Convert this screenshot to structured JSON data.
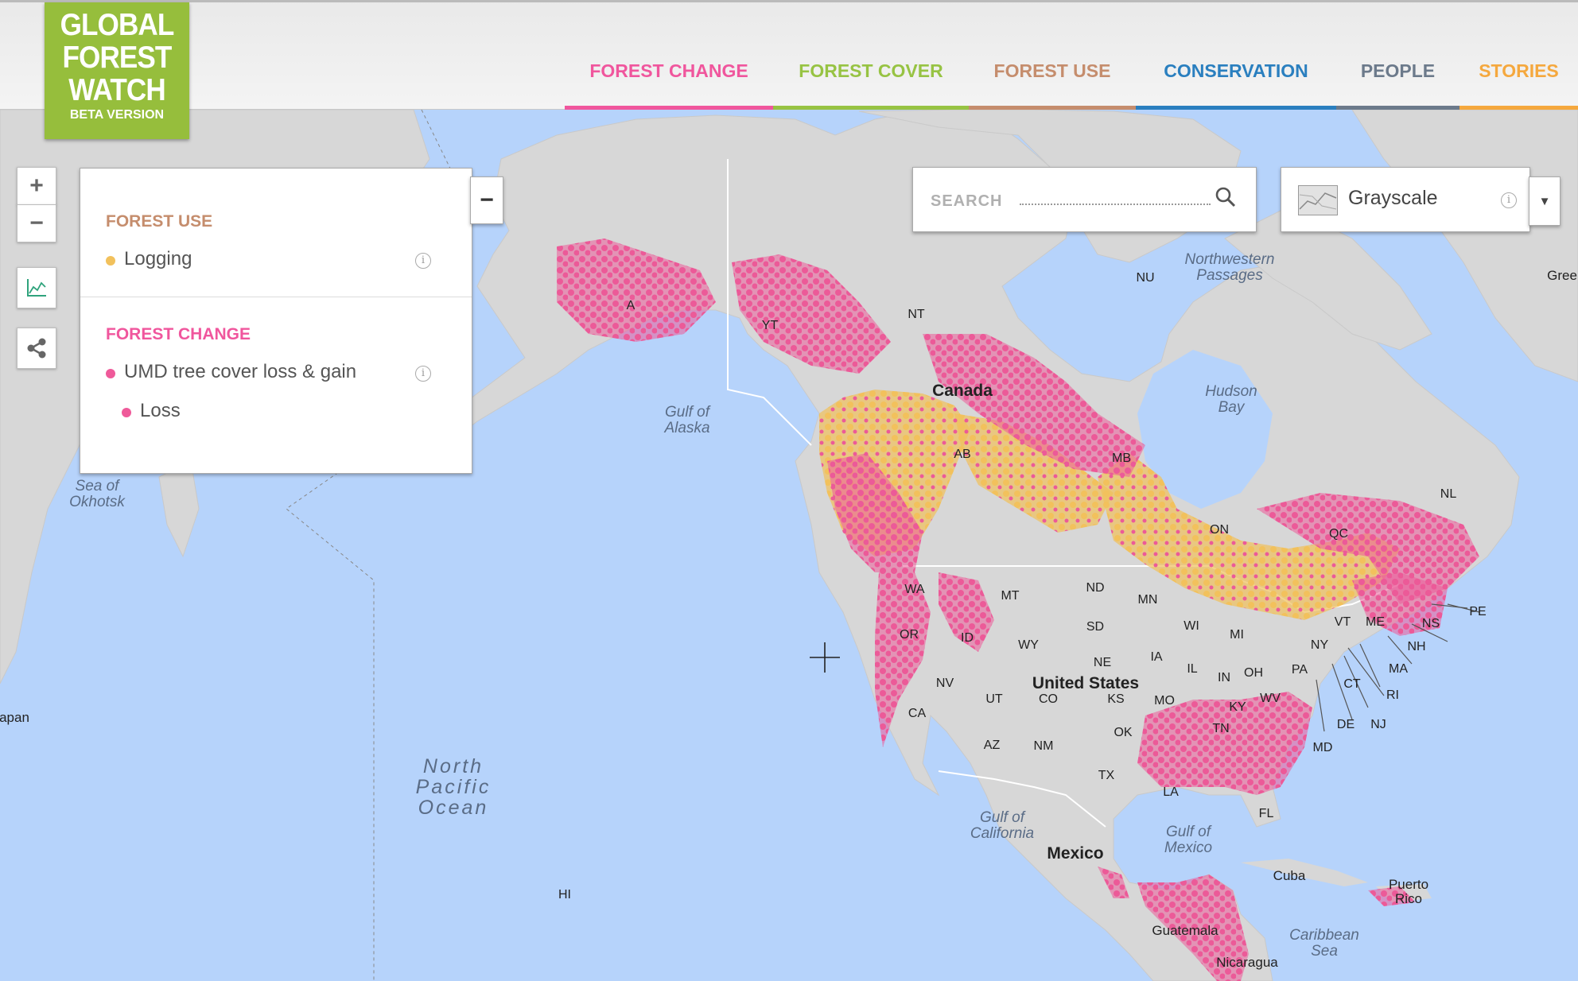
{
  "header": {
    "logo_lines": [
      "GLOBAL",
      "FOREST",
      "WATCH"
    ],
    "logo_sub": "BETA VERSION",
    "nav": [
      {
        "label": "FOREST CHANGE",
        "color": "#f0569d"
      },
      {
        "label": "FOREST COVER",
        "color": "#97c343"
      },
      {
        "label": "FOREST USE",
        "color": "#c58d6d"
      },
      {
        "label": "CONSERVATION",
        "color": "#2a7fbf"
      },
      {
        "label": "PEOPLE",
        "color": "#6c7a8b"
      },
      {
        "label": "STORIES",
        "color": "#f5a83e"
      }
    ]
  },
  "controls": {
    "zoom_in": "+",
    "zoom_out": "−",
    "collapse": "−"
  },
  "legend": {
    "forest_use": {
      "title": "FOREST USE",
      "color": "#c58d6d",
      "items": [
        {
          "label": "Logging",
          "color": "#f2c15c"
        }
      ]
    },
    "forest_change": {
      "title": "FOREST CHANGE",
      "color": "#f0569d",
      "items": [
        {
          "label": "UMD tree cover loss & gain",
          "color": "#ef5a9a"
        },
        {
          "label": "Loss",
          "color": "#ef5a9a"
        }
      ]
    }
  },
  "search": {
    "placeholder": "SEARCH"
  },
  "basemap": {
    "selected": "Grayscale"
  },
  "map": {
    "colors": {
      "water": "#b6d3fb",
      "land": "#d7d7d7",
      "forest_loss": "#ec5a98",
      "logging": "#f2c15c"
    },
    "labels": {
      "countries": [
        "Canada",
        "United States",
        "Mexico"
      ],
      "oceans": [
        "North\nPacific\nOcean"
      ],
      "water": [
        "Gulf of\nAlaska",
        "Sea of\nOkhotsk",
        "Hudson\nBay",
        "Gulf of\nCalifornia",
        "Gulf of\nMexico",
        "Caribbean\nSea",
        "Northwestern\nPassages"
      ],
      "places": [
        "Cuba",
        "Puerto\nRico",
        "Guatemala",
        "Nicaragua",
        "apan",
        "Gree"
      ],
      "regions": [
        "YT",
        "NT",
        "NU",
        "AB",
        "MB",
        "ON",
        "QC",
        "NL",
        "PE",
        "NS",
        "HI",
        "A"
      ],
      "states": [
        "WA",
        "OR",
        "CA",
        "ID",
        "NV",
        "MT",
        "WY",
        "UT",
        "AZ",
        "CO",
        "NM",
        "ND",
        "SD",
        "NE",
        "KS",
        "OK",
        "TX",
        "MN",
        "IA",
        "MO",
        "WI",
        "IL",
        "MI",
        "IN",
        "OH",
        "KY",
        "TN",
        "LA",
        "FL",
        "WV",
        "PA",
        "NY",
        "VT",
        "ME",
        "NH",
        "MA",
        "CT",
        "RI",
        "NJ",
        "DE",
        "MD"
      ]
    }
  }
}
